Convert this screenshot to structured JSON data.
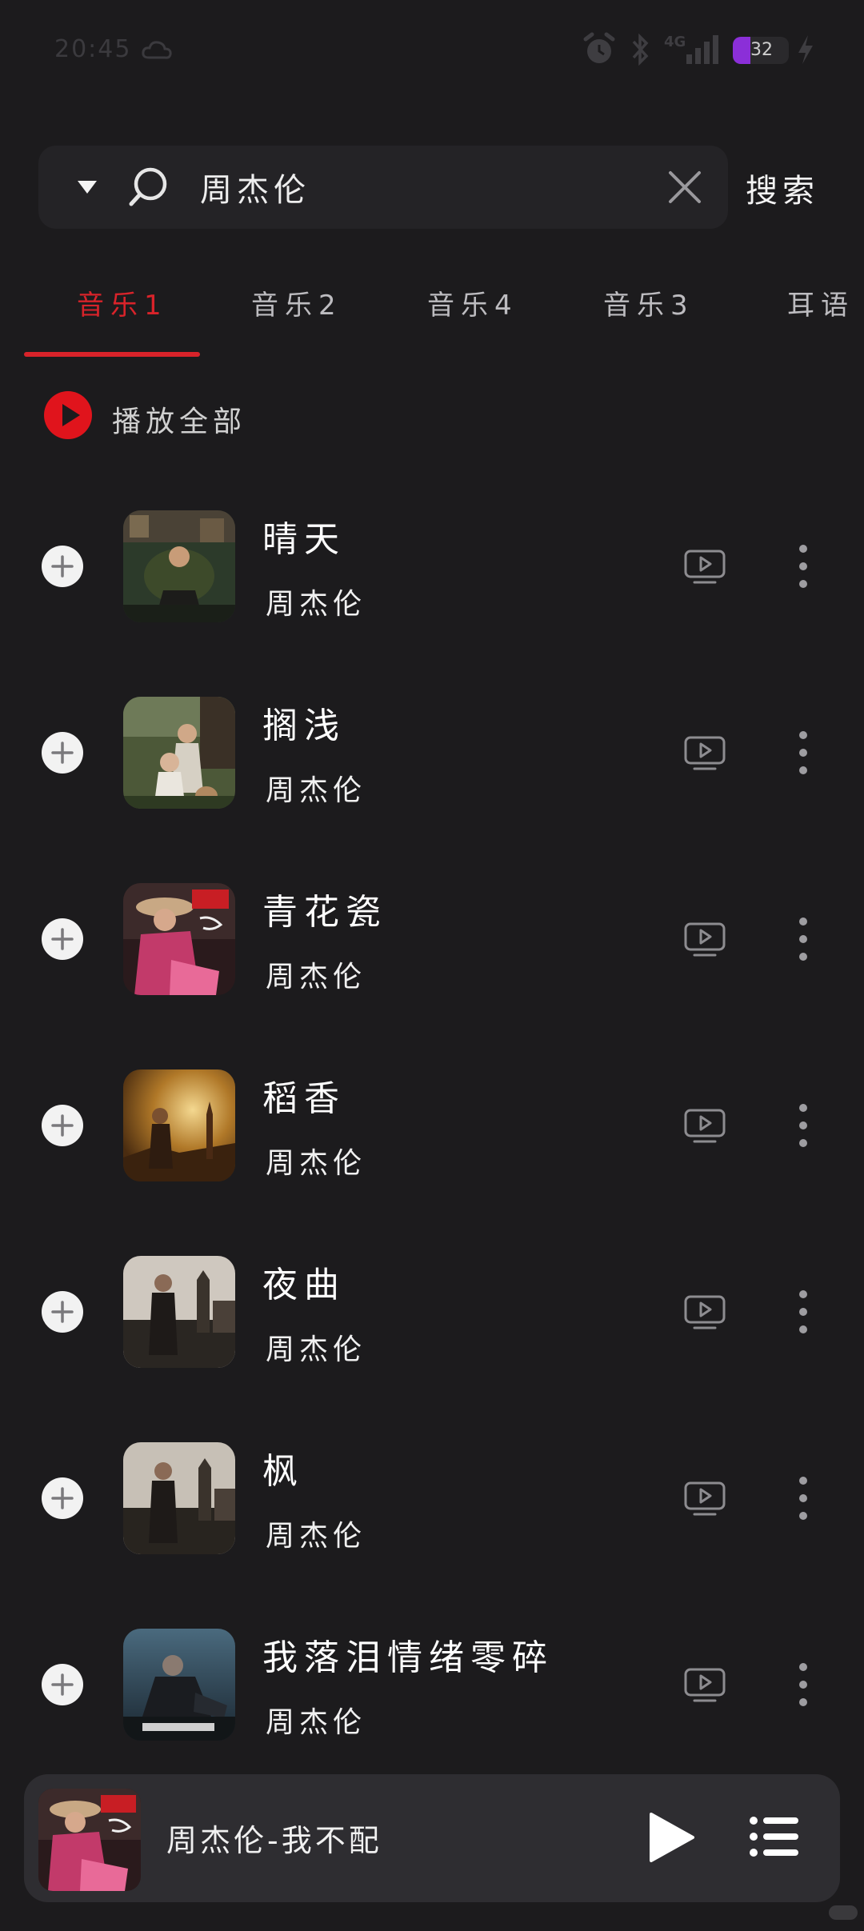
{
  "status_bar": {
    "time": "20:45",
    "network": "4G",
    "battery": "32",
    "icons": [
      "weather-icon",
      "alarm-icon",
      "bluetooth-icon",
      "signal-icon",
      "battery-icon",
      "charging-icon"
    ]
  },
  "search": {
    "query": "周杰伦",
    "button_label": "搜索"
  },
  "tabs": [
    {
      "label": "音乐1",
      "active": true
    },
    {
      "label": "音乐2",
      "active": false
    },
    {
      "label": "音乐4",
      "active": false
    },
    {
      "label": "音乐3",
      "active": false
    },
    {
      "label": "耳语",
      "active": false
    }
  ],
  "play_all": {
    "label": "播放全部"
  },
  "songs": [
    {
      "title": "晴天",
      "artist": "周杰伦"
    },
    {
      "title": "搁浅",
      "artist": "周杰伦"
    },
    {
      "title": "青花瓷",
      "artist": "周杰伦"
    },
    {
      "title": "稻香",
      "artist": "周杰伦"
    },
    {
      "title": "夜曲",
      "artist": "周杰伦"
    },
    {
      "title": "枫",
      "artist": "周杰伦"
    },
    {
      "title": "我落泪情绪零碎",
      "artist": "周杰伦"
    }
  ],
  "now_playing": {
    "title": "周杰伦-我不配"
  },
  "colors": {
    "accent": "#d8232a",
    "background": "#1c1b1d",
    "mini_player": "#2e2d31"
  }
}
